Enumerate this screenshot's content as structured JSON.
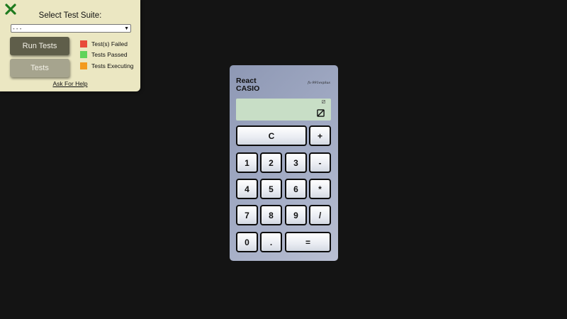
{
  "test_panel": {
    "title": "Select Test Suite:",
    "suite_select": {
      "value": "- - -"
    },
    "run_tests_label": "Run Tests",
    "tests_label": "Tests",
    "legend": [
      {
        "label": "Test(s) Failed",
        "color": "#e84a3a"
      },
      {
        "label": "Tests Passed",
        "color": "#5fd35a"
      },
      {
        "label": "Tests Executing",
        "color": "#f39a1e"
      }
    ],
    "help_link": "Ask For Help",
    "close_icon": "close-x-icon",
    "accent_color": "#1e7a1e"
  },
  "calculator": {
    "brand_line1": "React",
    "brand_line2": "CASIO",
    "model": "fx-991esplus",
    "display_icon": "slashed-square-icon",
    "keys": {
      "clear": "C",
      "plus": "+",
      "one": "1",
      "two": "2",
      "three": "3",
      "minus": "-",
      "four": "4",
      "five": "5",
      "six": "6",
      "multiply": "*",
      "seven": "7",
      "eight": "8",
      "nine": "9",
      "divide": "/",
      "zero": "0",
      "decimal": ".",
      "equals": "="
    }
  }
}
